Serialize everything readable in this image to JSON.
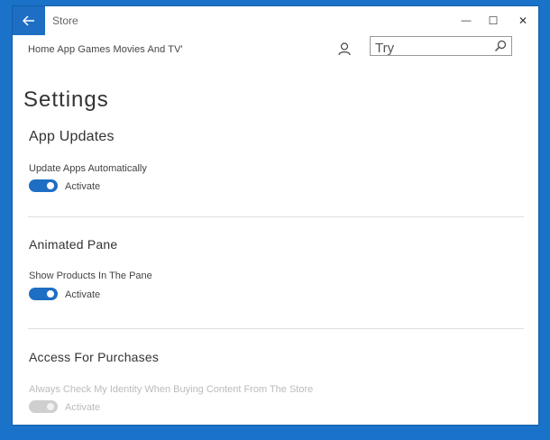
{
  "app": {
    "title": "Store"
  },
  "window_controls": {
    "minimize": "—",
    "maximize": "☐",
    "close": "✕"
  },
  "nav": {
    "items": [
      "Home",
      "App",
      "Games",
      "Movies And TV'"
    ]
  },
  "search": {
    "value": "Try"
  },
  "page": {
    "title": "Settings"
  },
  "sections": [
    {
      "title": "App Updates",
      "setting": "Update Apps Automatically",
      "toggle": {
        "state": "on",
        "label": "Activate"
      }
    },
    {
      "title": "Animated Pane",
      "setting": "Show Products In The Pane",
      "toggle": {
        "state": "on",
        "label": "Activate"
      }
    },
    {
      "title": "Access For Purchases",
      "setting": "Always Check My Identity When Buying Content From The Store",
      "toggle": {
        "state": "disabled",
        "label": "Activate"
      }
    }
  ],
  "colors": {
    "accent": "#1e6ec4",
    "frame": "#1a73c8"
  }
}
